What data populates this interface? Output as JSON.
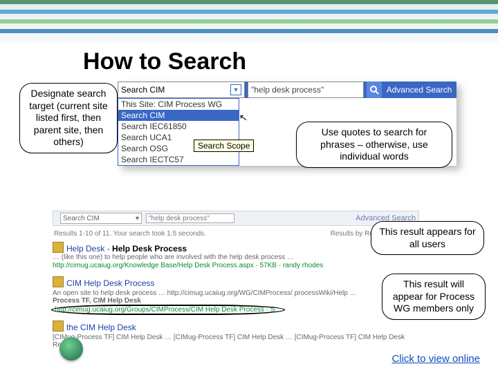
{
  "title": "How to Search",
  "callouts": {
    "scope": "Designate search target (current site listed first, then parent site, then others)",
    "quotes": "Use quotes to search for phrases – otherwise, use individual words",
    "allusers": "This result appears for all users",
    "members": "This result will appear for Process WG members only"
  },
  "search": {
    "scope_selected": "Search CIM",
    "query": "\"help desk process\"",
    "advanced": "Advanced Search",
    "tooltip": "Search Scope",
    "options": [
      "This Site: CIM Process WG",
      "Search CIM",
      "Search IEC61850",
      "Search UCA1",
      "Search OSG",
      "Search IECTC57"
    ]
  },
  "results_bar": {
    "scope": "Search CIM",
    "query": "\"help desk process\"",
    "advanced": "Advanced Search"
  },
  "results_meta": {
    "left": "Results 1-10 of 11. Your search took 1.5 seconds.",
    "right": "Results by Relevance | View"
  },
  "hit1": {
    "title_pre": "Help Desk - ",
    "title_bold": "Help Desk Process",
    "desc": "… (like this one) to help people who are involved with the help desk process …",
    "url": "http://cimug.ucaiug.org/Knowledge Base/Help Desk Process.aspx · 57KB · randy rhodes"
  },
  "wg": {
    "title1": "CIM Help Desk Process",
    "desc1": "An open site to help desk process … http://cimug.ucaiug.org/WG/CIMProcess/ processWiki/Help …",
    "tag": "Process TF, CIM Help Desk",
    "url_circled": "http://cimug.ucaiug.org/Groups/CIMProcess/CIM Help Desk Process · S…",
    "title2": "the CIM Help Desk",
    "desc2": "[CIMug-Process TF] CIM Help Desk … [CIMug-Process TF] CIM Help Desk …  [CIMug-Process TF] CIM Help Desk Request"
  },
  "online_link": "Click to view online"
}
